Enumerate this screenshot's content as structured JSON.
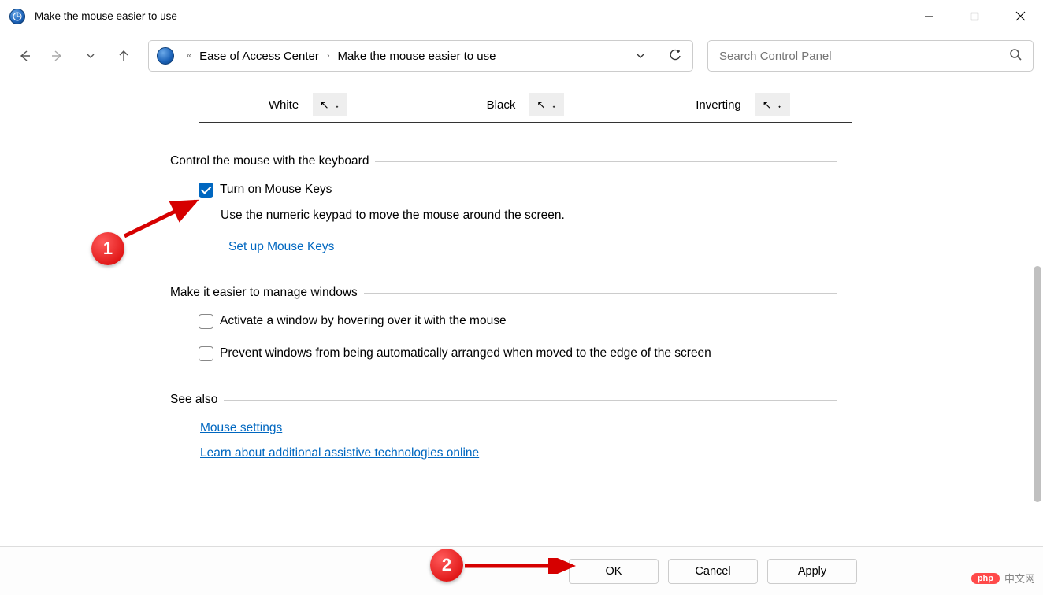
{
  "window": {
    "title": "Make the mouse easier to use"
  },
  "breadcrumb": {
    "seg1": "Ease of Access Center",
    "seg2": "Make the mouse easier to use"
  },
  "search": {
    "placeholder": "Search Control Panel"
  },
  "pointer_row": {
    "white": "White",
    "black": "Black",
    "inverting": "Inverting"
  },
  "sections": {
    "keyboard_control": {
      "heading": "Control the mouse with the keyboard",
      "mouse_keys_label": "Turn on Mouse Keys",
      "mouse_keys_desc": "Use the numeric keypad to move the mouse around the screen.",
      "setup_link": "Set up Mouse Keys"
    },
    "manage_windows": {
      "heading": "Make it easier to manage windows",
      "hover_label": "Activate a window by hovering over it with the mouse",
      "snap_label": "Prevent windows from being automatically arranged when moved to the edge of the screen"
    },
    "see_also": {
      "heading": "See also",
      "mouse_settings": "Mouse settings",
      "learn_link": "Learn about additional assistive technologies online"
    }
  },
  "buttons": {
    "ok": "OK",
    "cancel": "Cancel",
    "apply": "Apply"
  },
  "annotations": {
    "one": "1",
    "two": "2"
  },
  "watermark": {
    "badge": "php",
    "text": "中文网"
  }
}
